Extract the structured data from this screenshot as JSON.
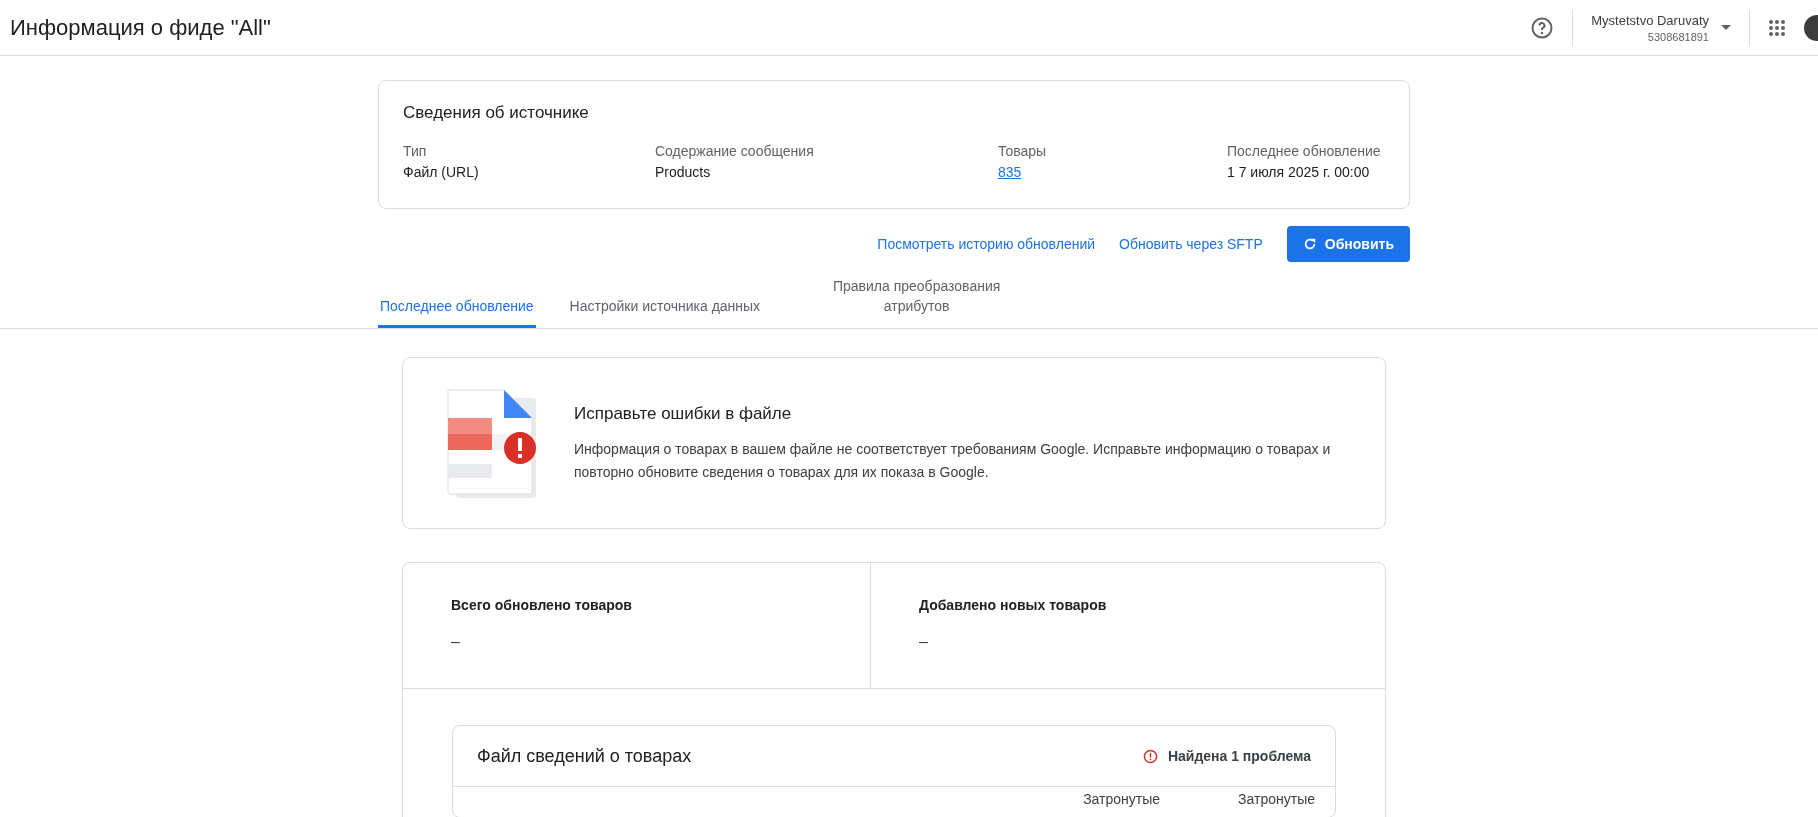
{
  "header": {
    "title": "Информация о фиде \"All\"",
    "account_name": "Mystetstvo Daruvaty",
    "account_id": "5308681891"
  },
  "source_card": {
    "title": "Сведения об источнике",
    "fields": [
      {
        "label": "Тип",
        "value": "Файл (URL)",
        "kind": "text"
      },
      {
        "label": "Содержание сообщения",
        "value": "Products",
        "kind": "text"
      },
      {
        "label": "Товары",
        "value": "835",
        "kind": "link"
      },
      {
        "label": "Последнее обновление",
        "value": "1 7 июля 2025 г. 00:00",
        "kind": "text"
      }
    ]
  },
  "actions": {
    "links": [
      "Посмотреть историю обновлений",
      "Обновить через SFTP"
    ],
    "button": "Обновить"
  },
  "tabs": [
    {
      "label": "Последнее обновление",
      "selected": true
    },
    {
      "label": "Настройки источника данных",
      "selected": false
    },
    {
      "label": "Правила преобразования атрибутов",
      "selected": false
    }
  ],
  "alert": {
    "title": "Исправьте ошибки в файле",
    "text": "Информация о товарах в вашем файле не соответствует требованиям Google. Исправьте информацию о товарах и повторно обновите сведения о товарах для их показа в Google."
  },
  "stats": [
    {
      "label": "Всего обновлено товаров",
      "value": "–"
    },
    {
      "label": "Добавлено новых товаров",
      "value": "–"
    }
  ],
  "file_card": {
    "title": "Файл сведений о товарах",
    "issues": "Найдена 1 проблема",
    "columns": [
      "Затронутые",
      "Затронутые"
    ]
  }
}
